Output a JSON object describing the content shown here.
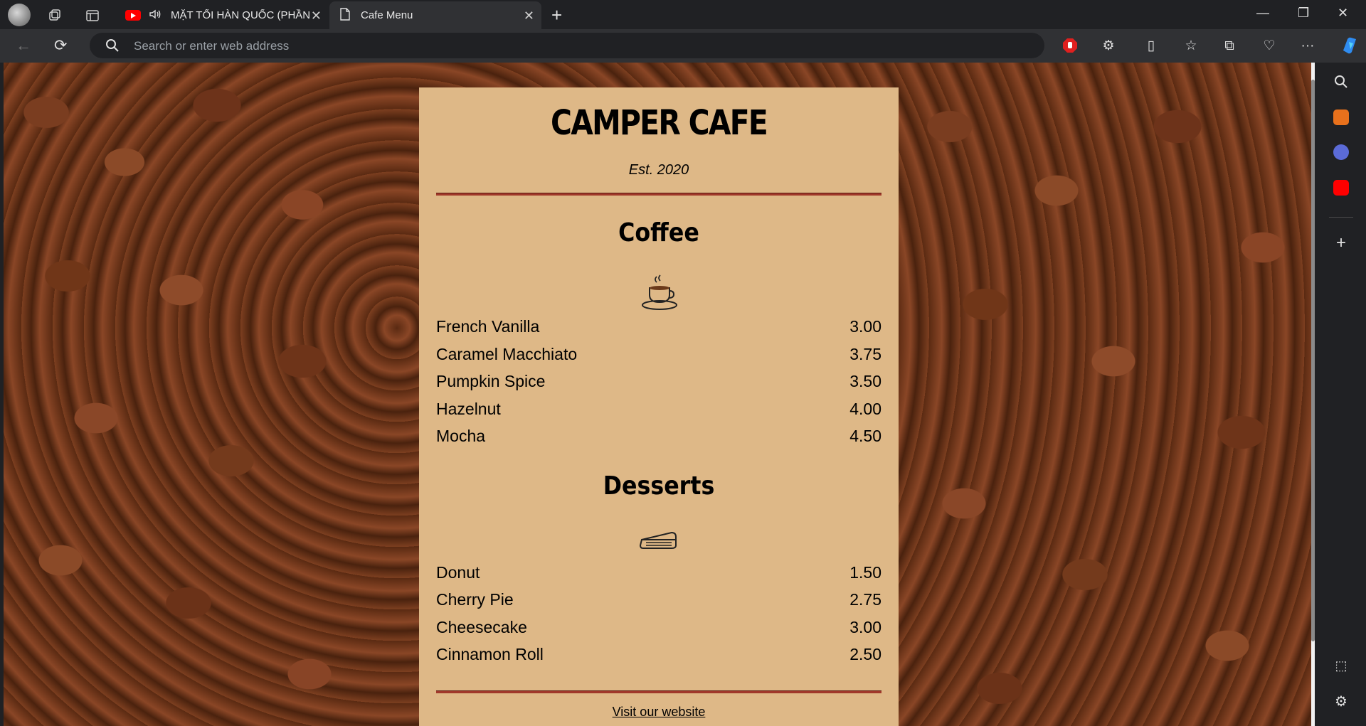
{
  "browser": {
    "tabs": [
      {
        "title": "MẶT TỐI HÀN QUỐC (PHẦN",
        "icon": "youtube-icon"
      },
      {
        "title": "Cafe Menu",
        "icon": "page-icon"
      }
    ],
    "address_placeholder": "Search or enter web address"
  },
  "menu": {
    "title": "CAMPER CAFE",
    "established": "Est. 2020",
    "sections": [
      {
        "title": "Coffee",
        "icon": "coffee-cup-icon",
        "items": [
          {
            "name": "French Vanilla",
            "price": "3.00"
          },
          {
            "name": "Caramel Macchiato",
            "price": "3.75"
          },
          {
            "name": "Pumpkin Spice",
            "price": "3.50"
          },
          {
            "name": "Hazelnut",
            "price": "4.00"
          },
          {
            "name": "Mocha",
            "price": "4.50"
          }
        ]
      },
      {
        "title": "Desserts",
        "icon": "pie-slice-icon",
        "items": [
          {
            "name": "Donut",
            "price": "1.50"
          },
          {
            "name": "Cherry Pie",
            "price": "2.75"
          },
          {
            "name": "Cheesecake",
            "price": "3.00"
          },
          {
            "name": "Cinnamon Roll",
            "price": "2.50"
          }
        ]
      }
    ],
    "footer_link": "Visit our website"
  },
  "colors": {
    "menu_background": "#deb887",
    "divider": "#a0382a",
    "browser_frame": "#202124"
  }
}
